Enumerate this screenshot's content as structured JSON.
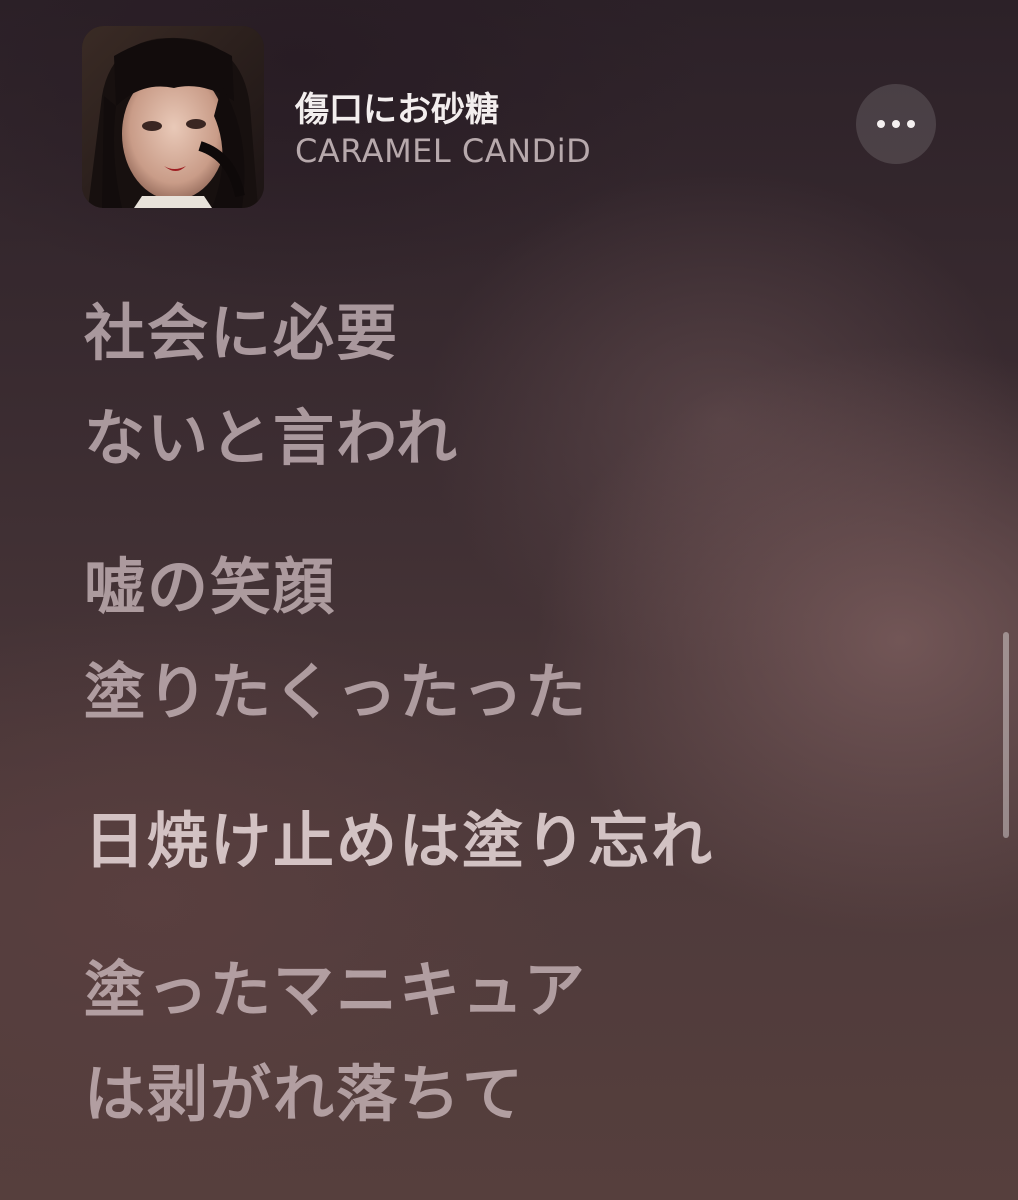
{
  "now_playing": {
    "title": "傷口にお砂糖",
    "artist": "CARAMEL CANDiD",
    "more_icon": "ellipsis-icon",
    "artwork_icon": "album-artwork"
  },
  "lyrics": {
    "blocks": [
      {
        "lines": [
          "社会に必要",
          "ないと言われ"
        ]
      },
      {
        "lines": [
          "嘘の笑顔",
          "塗りたくったった"
        ]
      },
      {
        "lines": [
          "日焼け止めは塗り忘れ"
        ]
      },
      {
        "lines": [
          "塗ったマニキュア",
          "は剥がれ落ちて"
        ]
      }
    ]
  }
}
